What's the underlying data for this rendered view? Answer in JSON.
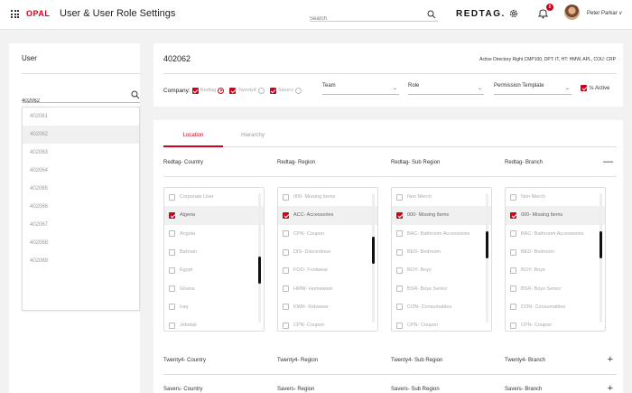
{
  "app": {
    "logo": "OPAL",
    "title": "User & User Role Settings",
    "brand": "REDTAG."
  },
  "search": {
    "placeholder": "Search"
  },
  "notifications": {
    "count": "8"
  },
  "user": {
    "name": "Peter Parkar",
    "caret": "v"
  },
  "user_panel": {
    "title": "User",
    "search_value": "402062",
    "list": [
      "402061",
      "402062",
      "402063",
      "402064",
      "402065",
      "402066",
      "402067",
      "402068",
      "402069"
    ],
    "selected": "402062"
  },
  "header": {
    "user_id": "402062",
    "meta": "Active Directory Right CMP100, DPT: IT, HT: HMW, APL, COU: CRP",
    "company_label": "Company:",
    "companies": [
      {
        "name": "Redtag",
        "checked": true,
        "radio_on": true
      },
      {
        "name": "Twenty4",
        "checked": true,
        "radio_on": false
      },
      {
        "name": "Savers",
        "checked": true,
        "radio_on": false
      }
    ],
    "team_placeholder": "Team",
    "role_placeholder": "Role",
    "permission_placeholder": "Permission Template",
    "is_active_label": "Is Active",
    "is_active": true
  },
  "tabs": [
    "Location",
    "Hierarchy"
  ],
  "active_tab": "Location",
  "sections": [
    {
      "expanded": true,
      "toggle": "—",
      "columns": [
        "Redtag- Country",
        "Redtag- Region",
        "Redtag- Sub Region",
        "Redtag- Branch"
      ],
      "lists": [
        {
          "items": [
            [
              "Corporate User",
              false
            ],
            [
              "Algeria",
              true
            ],
            [
              "Angola",
              false
            ],
            [
              "Bahrain",
              false
            ],
            [
              "Egypt",
              false
            ],
            [
              "Ghana",
              false
            ],
            [
              "Iraq",
              false
            ],
            [
              "Jebelali",
              false
            ]
          ]
        },
        {
          "items": [
            [
              "000- Missing Items",
              false
            ],
            [
              "ACC- Accessories",
              true
            ],
            [
              "CPN- Coupon",
              false
            ],
            [
              "DIS- Discontinue",
              false
            ],
            [
              "FOO- Footwear",
              false
            ],
            [
              "HMW- Homeware",
              false
            ],
            [
              "KWR- Kidswear",
              false
            ],
            [
              "CPN- Coupon",
              false
            ]
          ]
        },
        {
          "items": [
            [
              "Non Merch",
              false
            ],
            [
              "000- Missing Items",
              true
            ],
            [
              "BAC- Bathroom Accessories",
              false
            ],
            [
              "BED- Bedroom",
              false
            ],
            [
              "BOY- Boys",
              false
            ],
            [
              "BSR- Boys Senior",
              false
            ],
            [
              "CON- Consumables",
              false
            ],
            [
              "CPN- Coupon",
              false
            ]
          ]
        },
        {
          "items": [
            [
              "Non Merch",
              false
            ],
            [
              "000- Missing Items",
              true
            ],
            [
              "BAC- Bathroom Accessories",
              false
            ],
            [
              "BED- Bedroom",
              false
            ],
            [
              "BOY- Boys",
              false
            ],
            [
              "BSR- Boys Senior",
              false
            ],
            [
              "CON- Consumables",
              false
            ],
            [
              "CPN- Coupon",
              false
            ]
          ]
        }
      ]
    },
    {
      "expanded": false,
      "toggle": "+",
      "columns": [
        "Twenty4- Country",
        "Twenty4- Region",
        "Twenty4- Sub Region",
        "Twenty4- Branch"
      ]
    },
    {
      "expanded": false,
      "toggle": "+",
      "columns": [
        "Savers- Country",
        "Savers- Region",
        "Savers- Sub Region",
        "Savers- Branch"
      ]
    }
  ],
  "colors": {
    "accent": "#d0021b",
    "background": "#f2f2f2"
  }
}
